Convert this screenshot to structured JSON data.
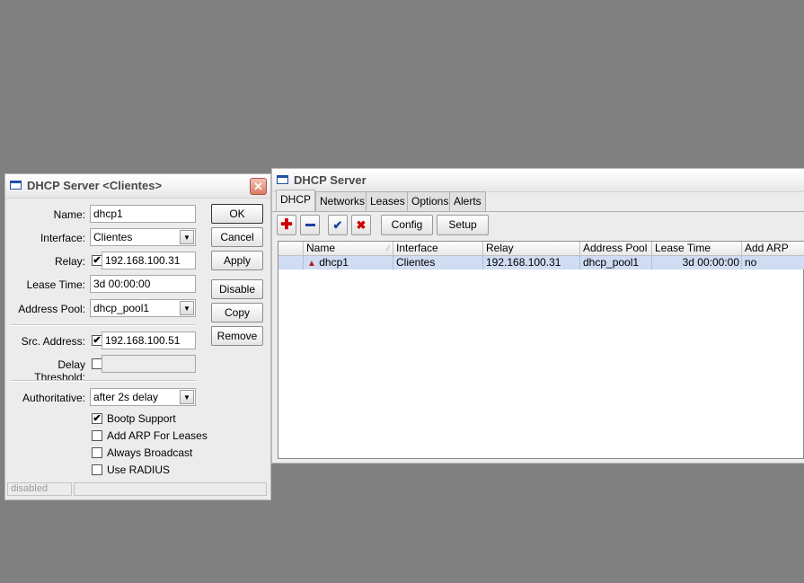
{
  "dialog": {
    "title": "DHCP Server <Clientes>",
    "close_glyph": "✕",
    "fields": {
      "name_label": "Name:",
      "name_value": "dhcp1",
      "interface_label": "Interface:",
      "interface_value": "Clientes",
      "relay_label": "Relay:",
      "relay_value": "192.168.100.31",
      "lease_time_label": "Lease Time:",
      "lease_time_value": "3d 00:00:00",
      "address_pool_label": "Address Pool:",
      "address_pool_value": "dhcp_pool1",
      "src_address_label": "Src. Address:",
      "src_address_value": "192.168.100.51",
      "delay_threshold_label": "Delay Threshold:",
      "delay_threshold_value": "",
      "authoritative_label": "Authoritative:",
      "authoritative_value": "after 2s delay"
    },
    "checks": {
      "relay_checked": true,
      "src_checked": true,
      "delay_checked": false
    },
    "options": [
      {
        "label": "Bootp Support",
        "checked": true
      },
      {
        "label": "Add ARP For Leases",
        "checked": false
      },
      {
        "label": "Always Broadcast",
        "checked": false
      },
      {
        "label": "Use RADIUS",
        "checked": false
      }
    ],
    "buttons": {
      "ok": "OK",
      "cancel": "Cancel",
      "apply": "Apply",
      "disable": "Disable",
      "copy": "Copy",
      "remove": "Remove"
    },
    "status": {
      "left": "disabled",
      "right": ""
    },
    "dropdown_glyph": "▼",
    "check_glyph": "✔"
  },
  "main_window": {
    "title": "DHCP Server",
    "tabs": [
      "DHCP",
      "Networks",
      "Leases",
      "Options",
      "Alerts"
    ],
    "active_tab": "DHCP",
    "toolbar": {
      "add_icon": "plus-icon",
      "remove_icon": "minus-icon",
      "enable_icon": "check-icon",
      "disable_icon": "x-icon",
      "config_label": "Config",
      "setup_label": "Setup"
    },
    "columns": [
      "Name",
      "Interface",
      "Relay",
      "Address Pool",
      "Lease Time",
      "Add ARP"
    ],
    "rows": [
      {
        "name": "dhcp1",
        "interface": "Clientes",
        "relay": "192.168.100.31",
        "address_pool": "dhcp_pool1",
        "lease_time": "3d 00:00:00",
        "add_arp": "no"
      }
    ],
    "colors": {
      "selected_row": "#cfdcf2",
      "add": "#cc0000",
      "remove": "#1f3f9f",
      "check": "#1f3f9f",
      "x": "#cc0000"
    }
  }
}
